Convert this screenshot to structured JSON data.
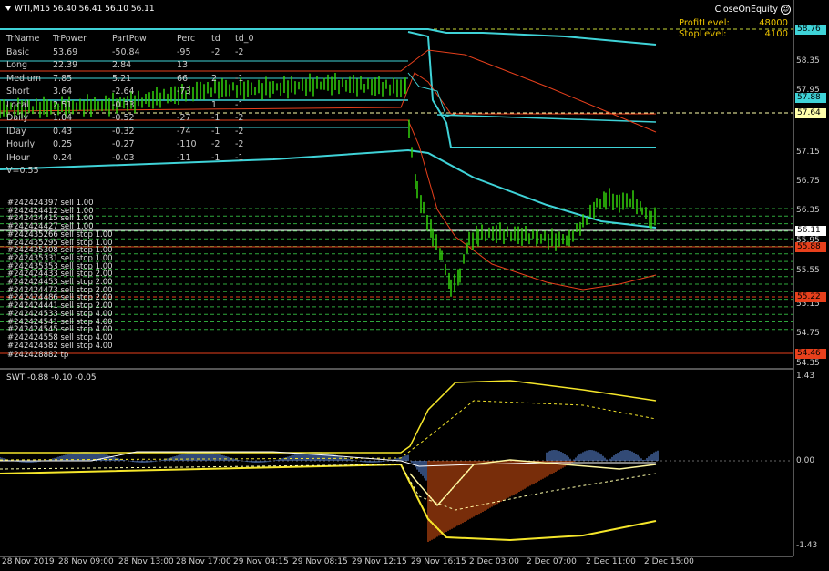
{
  "header": {
    "symbol_line": "WTI,M15  56.40 56.41 56.10 56.11"
  },
  "close_on_equity": {
    "label": "CloseOnEquity"
  },
  "profit_panel": {
    "profit_label": "ProfitLevel:",
    "profit_value": "48000",
    "stop_label": "StopLevel:",
    "stop_value": "4100"
  },
  "table": {
    "headers": [
      "TrName",
      "TrPower",
      "PartPow",
      "Perc",
      "td",
      "td_0"
    ],
    "rows": [
      [
        "Basic",
        "53.69",
        "-50.84",
        "-95",
        "-2",
        "-2"
      ],
      [
        "Long",
        "22.39",
        "2.84",
        "13",
        "",
        ""
      ],
      [
        "Medium",
        "7.85",
        "5.21",
        "66",
        "2",
        "-1"
      ],
      [
        "Short",
        "3.64",
        "-2.64",
        "-73",
        "",
        ""
      ],
      [
        "Local",
        "2.51",
        "-0.33",
        "",
        "1",
        "-1"
      ],
      [
        "Daily",
        "1.04",
        "-0.52",
        "-27",
        "-1",
        "-2"
      ],
      [
        "IDay",
        "0.43",
        "-0.32",
        "-74",
        "-1",
        "-2"
      ],
      [
        "Hourly",
        "0.25",
        "-0.27",
        "-110",
        "-2",
        "-2"
      ],
      [
        "IHour",
        "0.24",
        "-0.03",
        "-11",
        "-1",
        "-1"
      ]
    ],
    "footer": "V=0.55"
  },
  "orders": [
    "#242424397 sell 1.00",
    "#242424412 sell 1.00",
    "#242424415 sell 1.00",
    "#242424427 sell 1.00",
    "#242435266 sell stop 1.00",
    "#242435295 sell stop 1.00",
    "#242435308 sell stop 1.00",
    "#242435331 sell stop 1.00",
    "#242435353 sell stop 1.00",
    "#242424433 sell stop 2.00",
    "#242424453 sell stop 2.00",
    "#242424473 sell stop 2.00",
    "#242424486 sell stop 2.00",
    "#242424441 sell stop 2.00",
    "#242424533 sell stop 4.00",
    "#242424541 sell stop 4.00",
    "#242424545 sell stop 4.00",
    "#242424558 sell stop 4.00",
    "#242424582 sell stop 4.00"
  ],
  "tp_label": "#242428882 tp",
  "price_axis": {
    "ticks": [
      "58.35",
      "57.95",
      "57.15",
      "56.75",
      "56.35",
      "55.95",
      "55.55",
      "55.15",
      "54.75",
      "54.35"
    ],
    "boxes": [
      {
        "text": "58.76",
        "bg": "#3fd3d8",
        "fg": "#000"
      },
      {
        "text": "57.88",
        "bg": "#3fd3d8",
        "fg": "#000"
      },
      {
        "text": "57.64",
        "bg": "#ffffaa",
        "fg": "#000"
      },
      {
        "text": "56.11",
        "bg": "#ffffff",
        "fg": "#000"
      },
      {
        "text": "55.88",
        "bg": "#e8401c",
        "fg": "#000"
      },
      {
        "text": "55.22",
        "bg": "#e8401c",
        "fg": "#000"
      },
      {
        "text": "54.46",
        "bg": "#e8401c",
        "fg": "#000"
      }
    ]
  },
  "indicator": {
    "title": "SWT -0.88 -0.10 -0.05",
    "ticks": [
      "1.43",
      "0.00",
      "-1.43"
    ]
  },
  "time_axis": [
    "28 Nov 2019",
    "28 Nov 09:00",
    "28 Nov 13:00",
    "28 Nov 17:00",
    "29 Nov 04:15",
    "29 Nov 08:15",
    "29 Nov 12:15",
    "29 Nov 16:15",
    "2 Dec 03:00",
    "2 Dec 07:00",
    "2 Dec 11:00",
    "2 Dec 15:00"
  ],
  "colors": {
    "bg": "#000000",
    "candle": "#32d10a",
    "cyan": "#3fd3d8",
    "red": "#e8401c",
    "yellow": "#f5e62a",
    "blue_hist": "#6495ed",
    "orange_hist": "#f05a14",
    "grid_green": "#2fa83c"
  }
}
